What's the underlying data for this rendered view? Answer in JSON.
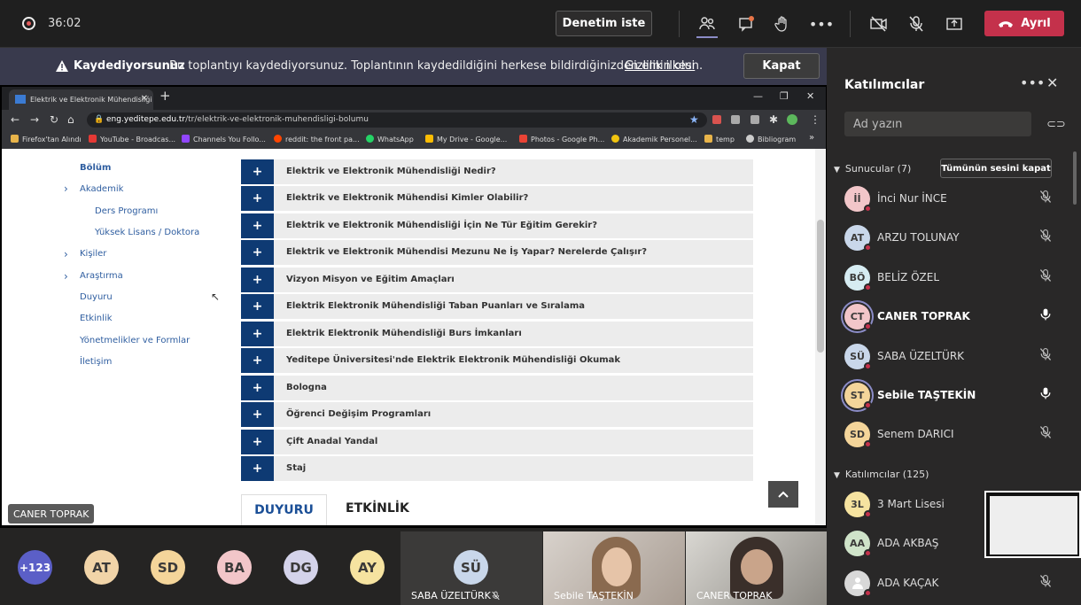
{
  "topbar": {
    "timer": "36:02",
    "help_label": "Denetim iste",
    "leave_label": "Ayrıl",
    "icons": [
      "people-icon",
      "chat-icon",
      "raise-hand-icon",
      "more-icon",
      "camera-off-icon",
      "mic-off-icon",
      "share-tray-icon",
      "phone-icon"
    ]
  },
  "notice": {
    "title": "Kaydediyorsunuz",
    "text": "Bu toplantıyı kaydediyorsunuz. Toplantının kaydedildiğini herkese bildirdiğinizden emin olun.",
    "link": "Gizlilik ilkesi",
    "close_label": "Kapat"
  },
  "browser": {
    "tab_title": "Elektrik ve Elektronik Mühendisliği",
    "url_host": "eng.yeditepe.edu.tr",
    "url_path": "/tr/elektrik-ve-elektronik-muhendisligi-bolumu",
    "bookmarks": [
      "Firefox'tan Alındı",
      "YouTube - Broadcas...",
      "Channels You Follo...",
      "reddit: the front pa...",
      "WhatsApp",
      "My Drive - Google...",
      "Photos - Google Ph...",
      "Akademik Personel...",
      "temp",
      "Bibliogram"
    ],
    "more": "»"
  },
  "site": {
    "sidebar": [
      "Bölüm",
      "Akademik",
      "Ders Programı",
      "Yüksek Lisans / Doktora",
      "Kişiler",
      "Araştırma",
      "Duyuru",
      "Etkinlik",
      "Yönetmelikler ve Formlar",
      "İletişim"
    ],
    "accordion": [
      "Elektrik ve Elektronik Mühendisliği Nedir?",
      "Elektrik ve Elektronik Mühendisi Kimler Olabilir?",
      "Elektrik ve Elektronik Mühendisliği İçin Ne Tür Eğitim Gerekir?",
      "Elektrik ve Elektronik Mühendisi Mezunu Ne İş Yapar? Nerelerde Çalışır?",
      "Vizyon Misyon ve Eğitim Amaçları",
      "Elektrik Elektronik Mühendisliği Taban Puanları ve Sıralama",
      "Elektrik Elektronik Mühendisliği Burs İmkanları",
      "Yeditepe Üniversitesi'nde Elektrik Elektronik Mühendisliği Okumak",
      "Bologna",
      "Öğrenci Değişim Programları",
      "Çift Anadal Yandal",
      "Staj"
    ],
    "plus": "+",
    "tab_duyuru": "DUYURU",
    "tab_etkinlik": "ETKİNLİK"
  },
  "presenter_chip": "CANER TOPRAK",
  "bottom": {
    "overflow": "+123",
    "avatars": [
      {
        "initials": "AT",
        "color": "#f1d4a8"
      },
      {
        "initials": "SD",
        "color": "#f4d59a"
      },
      {
        "initials": "BA",
        "color": "#f2c6c9"
      },
      {
        "initials": "DG",
        "color": "#d4d3ea"
      },
      {
        "initials": "AY",
        "color": "#f6e3a0"
      }
    ],
    "tiles": [
      {
        "initials": "SÜ",
        "name": "SABA ÜZELTÜRK"
      },
      {
        "name": "Sebile TAŞTEKİN"
      },
      {
        "name": "CANER TOPRAK"
      }
    ]
  },
  "panel": {
    "title": "Katılımcılar",
    "search_placeholder": "Ad yazın",
    "presenters_label": "Sunucular (7)",
    "mute_all": "Tümünün sesini kapat",
    "attendees_label": "Katılımcılar (125)",
    "presenters": [
      {
        "initials": "İİ",
        "name": "İnci Nur İNCE",
        "color": "#f2c6c9",
        "bold": false,
        "mic": "off"
      },
      {
        "initials": "AT",
        "name": "ARZU TOLUNAY",
        "color": "#c9d7ea",
        "bold": false,
        "mic": "off"
      },
      {
        "initials": "BÖ",
        "name": "BELİZ ÖZEL",
        "color": "#d6ecf2",
        "bold": false,
        "mic": "off"
      },
      {
        "initials": "CT",
        "name": "CANER TOPRAK",
        "color": "#f2c6c9",
        "bold": true,
        "mic": "on"
      },
      {
        "initials": "SÜ",
        "name": "SABA ÜZELTÜRK",
        "color": "#c9d7ea",
        "bold": false,
        "mic": "off"
      },
      {
        "initials": "ST",
        "name": "Sebile TAŞTEKİN",
        "color": "#f4d59a",
        "bold": true,
        "mic": "on"
      },
      {
        "initials": "SD",
        "name": "Senem DARICI",
        "color": "#f4d59a",
        "bold": false,
        "mic": "off"
      }
    ],
    "attendees": [
      {
        "initials": "3L",
        "name": "3 Mart Lisesi",
        "color": "#f6e3a0",
        "bold": false,
        "mic": "off"
      },
      {
        "initials": "AA",
        "name": "ADA AKBAŞ",
        "color": "#cfe3c9",
        "bold": false,
        "mic": "off"
      },
      {
        "initials": "",
        "name": "ADA KAÇAK",
        "color": "#d8d8d8",
        "bold": false,
        "mic": "off"
      }
    ]
  }
}
